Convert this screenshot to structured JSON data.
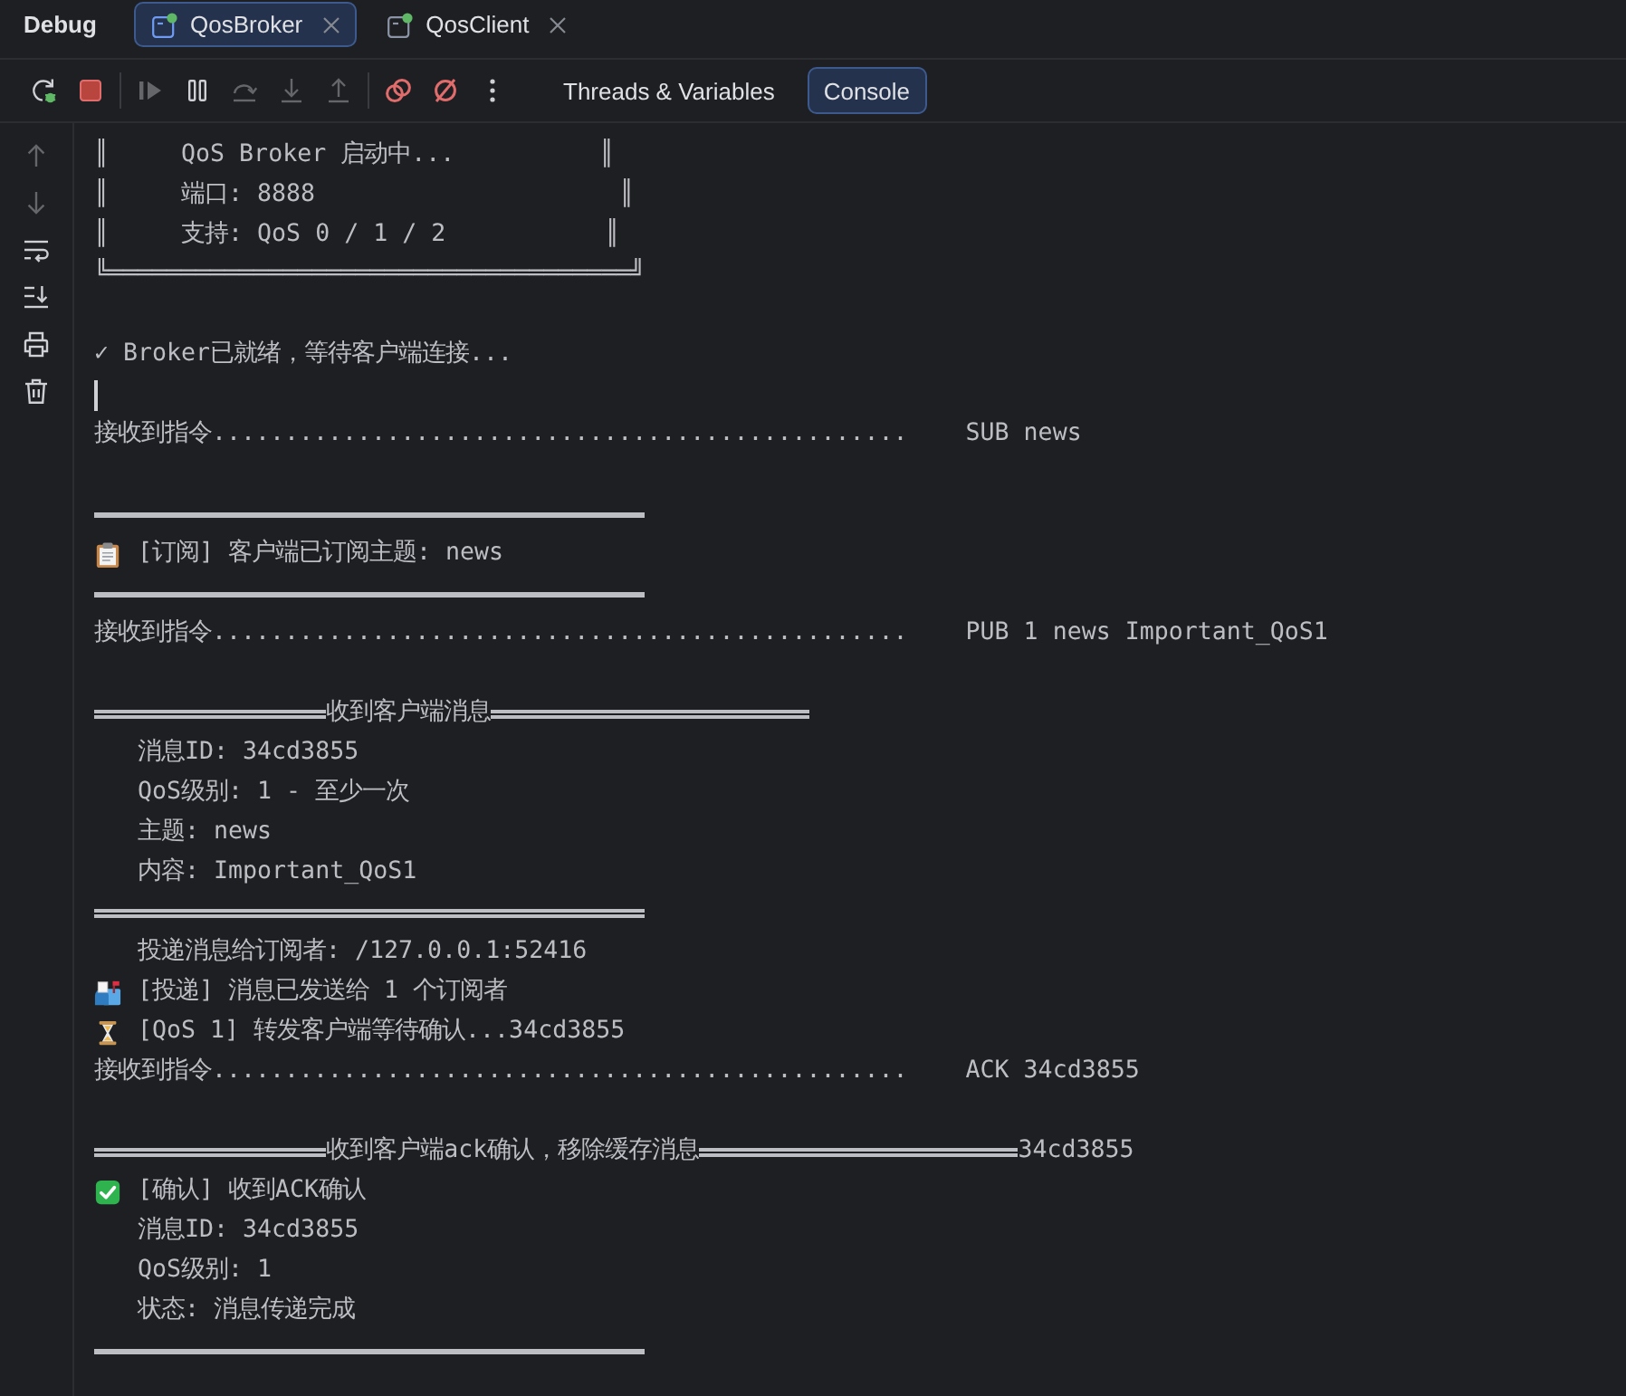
{
  "panel": {
    "title": "Debug"
  },
  "tabs": [
    {
      "label": "QosBroker",
      "selected": true,
      "running": true
    },
    {
      "label": "QosClient",
      "selected": false,
      "running": true
    }
  ],
  "toolbar": {
    "buttons": [
      {
        "disabled": false
      },
      {
        "disabled": false
      },
      {
        "disabled": true
      },
      {
        "disabled": false
      },
      {
        "disabled": true
      },
      {
        "disabled": true
      },
      {
        "disabled": true
      },
      {
        "disabled": false
      },
      {
        "disabled": false
      },
      {
        "disabled": false
      }
    ],
    "view_tabs": [
      {
        "label": "Threads & Variables",
        "selected": false
      },
      {
        "label": "Console",
        "selected": true
      }
    ]
  },
  "gutter": {
    "buttons": [
      {
        "disabled": true
      },
      {
        "disabled": true
      },
      {
        "disabled": false
      },
      {
        "disabled": false
      },
      {
        "disabled": false
      },
      {
        "disabled": false
      }
    ]
  },
  "console": {
    "lines": [
      {
        "kind": "banner",
        "text": "║     QoS Broker 启动中...          ║"
      },
      {
        "kind": "banner",
        "text": "║     端口: 8888                     ║"
      },
      {
        "kind": "banner",
        "text": "║     支持: QoS 0 / 1 / 2           ║"
      },
      {
        "kind": "banner",
        "text": "╚════════════════════════════════════╝"
      },
      {
        "kind": "blank"
      },
      {
        "kind": "text",
        "text": "✓ Broker已就绪，等待客户端连接..."
      },
      {
        "kind": "cursor"
      },
      {
        "kind": "command",
        "label": "接收到指令................................................",
        "command": "SUB news"
      },
      {
        "kind": "blank"
      },
      {
        "kind": "heavy_rule"
      },
      {
        "kind": "clipboard",
        "text": "[订阅] 客户端已订阅主题: news"
      },
      {
        "kind": "heavy_rule"
      },
      {
        "kind": "command",
        "label": "接收到指令................................................",
        "command": "PUB 1 news Important_QoS1"
      },
      {
        "kind": "blank"
      },
      {
        "kind": "titled_rule",
        "title": "收到客户端消息"
      },
      {
        "kind": "detail",
        "text": "消息ID: 34cd3855"
      },
      {
        "kind": "detail",
        "text": "QoS级别: 1 - 至少一次"
      },
      {
        "kind": "detail",
        "text": "主题: news"
      },
      {
        "kind": "detail",
        "text": "内容: Important_QoS1"
      },
      {
        "kind": "double_rule"
      },
      {
        "kind": "detail",
        "text": "投递消息给订阅者: /127.0.0.1:52416"
      },
      {
        "kind": "mailbox",
        "text": "[投递] 消息已发送给 1 个订阅者"
      },
      {
        "kind": "hourglass",
        "text": "[QoS 1] 转发客户端等待确认...34cd3855"
      },
      {
        "kind": "command",
        "label": "接收到指令................................................",
        "command": "ACK 34cd3855"
      },
      {
        "kind": "blank"
      },
      {
        "kind": "titled_rule",
        "title": "收到客户端ack确认，移除缓存消息",
        "suffix": "34cd3855"
      },
      {
        "kind": "checkmark",
        "text": "[确认] 收到ACK确认"
      },
      {
        "kind": "detail",
        "text": "消息ID: 34cd3855"
      },
      {
        "kind": "detail",
        "text": "QoS级别: 1"
      },
      {
        "kind": "detail",
        "text": "状态: 消息传递完成"
      },
      {
        "kind": "heavy_rule"
      }
    ]
  }
}
